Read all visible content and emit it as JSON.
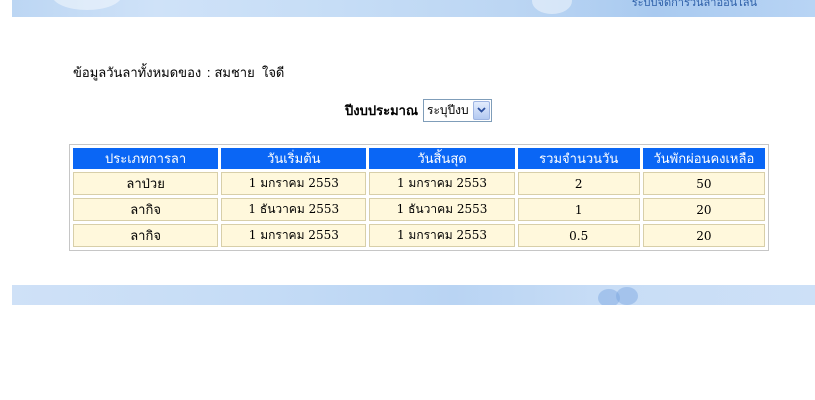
{
  "header": {
    "banner_text": "ระบบจัดการวันลาออนไลน์"
  },
  "employee": {
    "label": "ข้อมูลวันลาทั้งหมดของ",
    "separator": ":",
    "first_name": "สมชาย",
    "last_name": "ใจดี"
  },
  "fiscal_year": {
    "label": "ปีงบประมาณ",
    "selected": "ระบุปีงบ"
  },
  "table": {
    "headers": [
      "ประเภทการลา",
      "วันเริ่มต้น",
      "วันสิ้นสุด",
      "รวมจำนวนวัน",
      "วันพักผ่อนคงเหลือ"
    ],
    "rows": [
      [
        "ลาป่วย",
        "1 มกราคม 2553",
        "1 มกราคม 2553",
        "2",
        "50"
      ],
      [
        "ลากิจ",
        "1 ธันวาคม 2553",
        "1 ธันวาคม 2553",
        "1",
        "20"
      ],
      [
        "ลากิจ",
        "1 มกราคม 2553",
        "1 มกราคม 2553",
        "0.5",
        "20"
      ]
    ]
  },
  "colors": {
    "header_bg": "#0a66f5",
    "cell_bg": "#fff8dc",
    "banner": "#bcd6f3"
  }
}
